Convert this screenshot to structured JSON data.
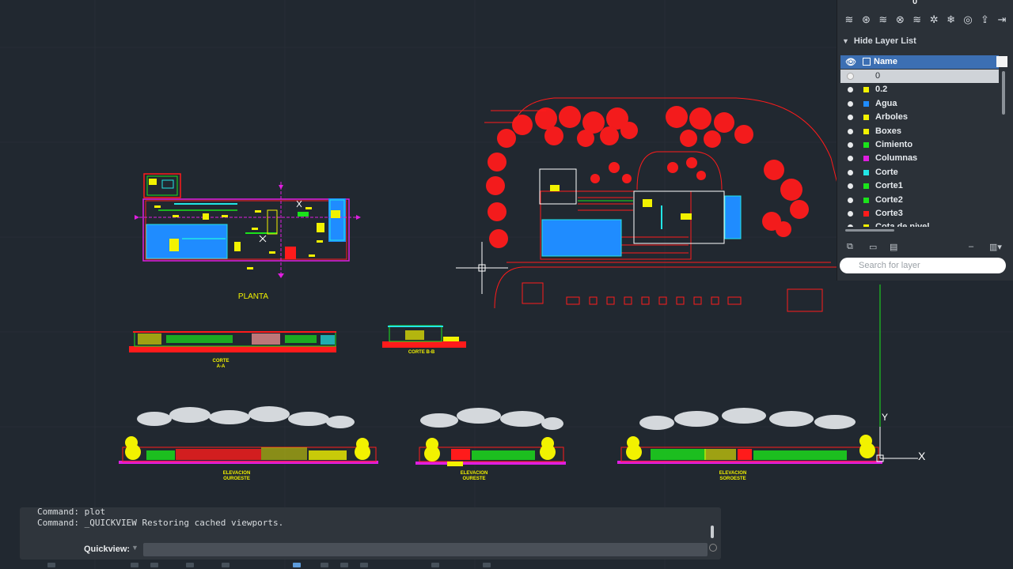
{
  "colors": {
    "background": "#212830",
    "red": "#ff1b1b",
    "yellow": "#f2f200",
    "green": "#1be31b",
    "blue": "#1f8cff",
    "cyan": "#22e6e6",
    "magenta": "#e01ee0",
    "white": "#ffffff"
  },
  "drawing": {
    "labels": {
      "planta": "PLANTA",
      "corte_aa": "CORTE\nA-A",
      "corte_bb": "CORTE B-B",
      "elev1": "ELEVACION\nOUROESTE",
      "elev2": "ELEVACION\nOURESTE",
      "elev3": "ELEVACION\nSOROESTE"
    },
    "ucs": {
      "y": "Y",
      "x": "X"
    }
  },
  "layers_palette": {
    "toolbar_icons": [
      "new-layer-icon",
      "new-layer-frozen-icon",
      "delete-layer-icon",
      "set-current-icon",
      "layer-state-icon",
      "isolate-icon",
      "freeze-icon",
      "lock-icon",
      "match-icon",
      "walk-icon"
    ],
    "current_layer_value": "0",
    "hide_list_label": "Hide Layer List",
    "header": {
      "name_label": "Name"
    },
    "layers": [
      {
        "name": "0",
        "color": "#ffffff",
        "selected": true
      },
      {
        "name": "0.2",
        "color": "#f2f200"
      },
      {
        "name": "Agua",
        "color": "#1f8cff"
      },
      {
        "name": "Arboles",
        "color": "#f2f200"
      },
      {
        "name": "Boxes",
        "color": "#f2f200"
      },
      {
        "name": "Cimiento",
        "color": "#1be31b"
      },
      {
        "name": "Columnas",
        "color": "#e01ee0"
      },
      {
        "name": "Corte",
        "color": "#22e6e6"
      },
      {
        "name": "Corte1",
        "color": "#1be31b"
      },
      {
        "name": "Corte2",
        "color": "#1be31b"
      },
      {
        "name": "Corte3",
        "color": "#ff1b1b"
      },
      {
        "name": "Cota de nivel",
        "color": "#f2f200"
      }
    ],
    "search_placeholder": "Search for layer"
  },
  "command": {
    "history": [
      "Command: plot",
      "Command: _QUICKVIEW Restoring cached viewports."
    ],
    "prompt_label": "Quickview:",
    "input_value": ""
  }
}
